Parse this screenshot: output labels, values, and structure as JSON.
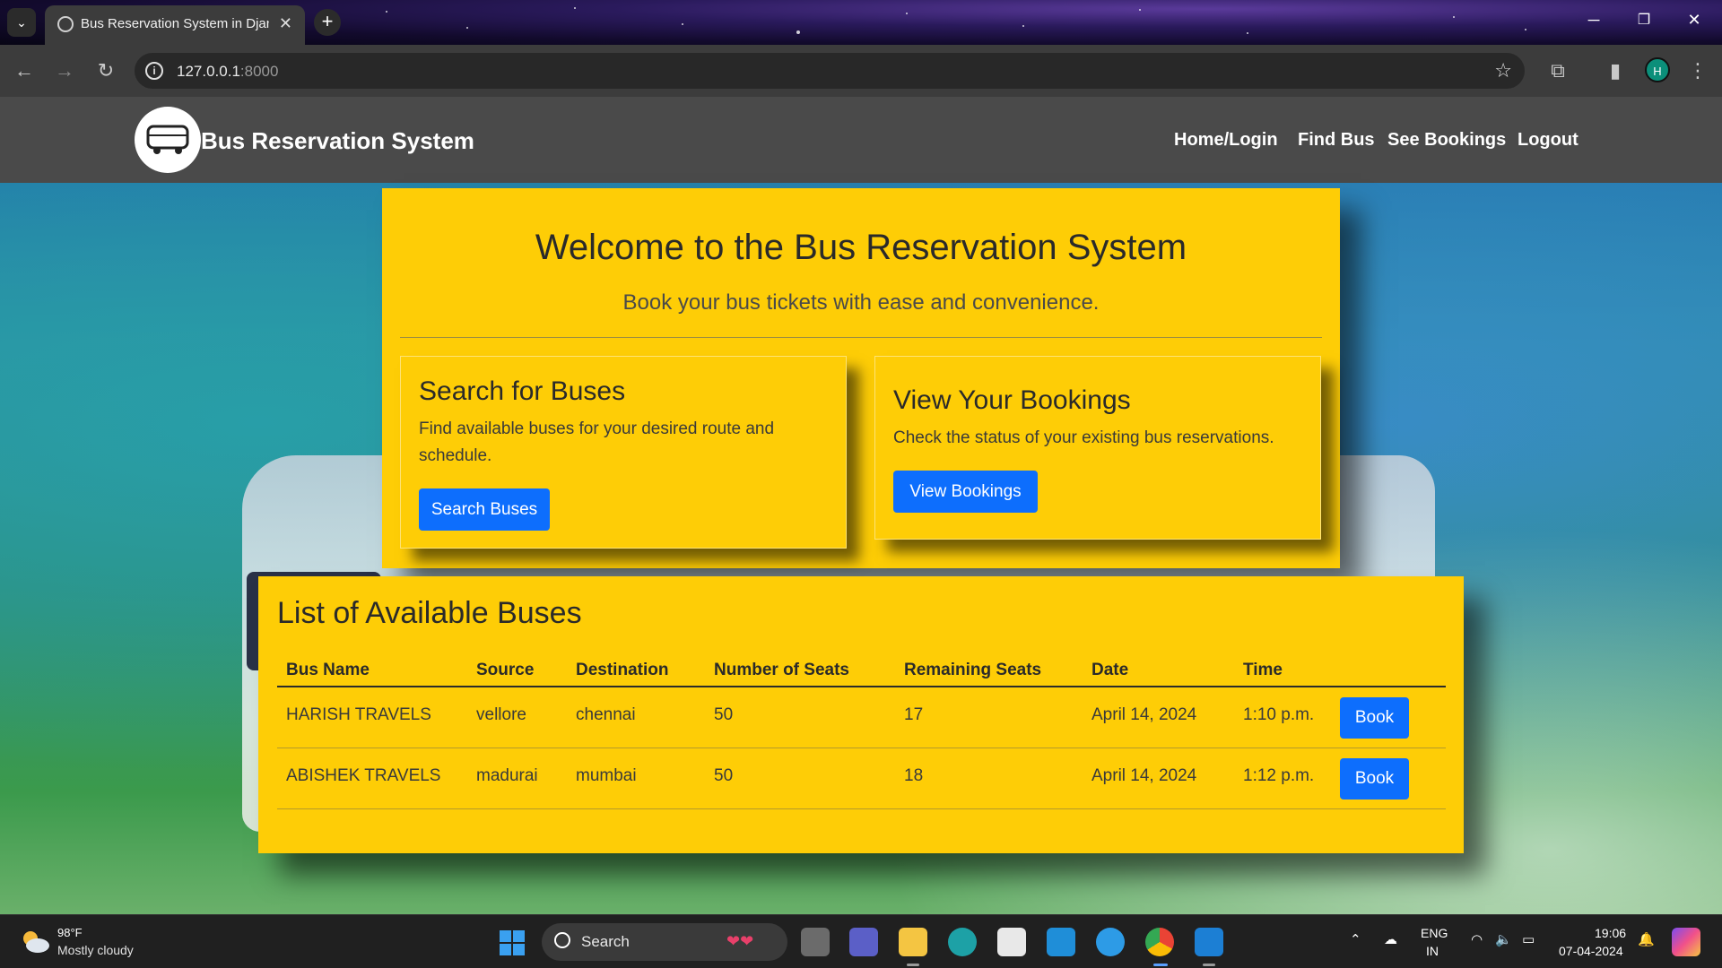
{
  "browser": {
    "tab_title": "Bus Reservation System in Django",
    "url_host": "127.0.0.1",
    "url_port": ":8000",
    "profile_initial": "H"
  },
  "navbar": {
    "brand": "Bus Reservation System",
    "links": [
      "Home/Login",
      "Find Bus",
      "See Bookings",
      "Logout"
    ]
  },
  "hero": {
    "title": "Welcome to the Bus Reservation System",
    "subtitle": "Book your bus tickets with ease and convenience."
  },
  "search_card": {
    "title": "Search for Buses",
    "text": "Find available buses for your desired route and schedule.",
    "button": "Search Buses"
  },
  "bookings_card": {
    "title": "View Your Bookings",
    "text": "Check the status of your existing bus reservations.",
    "button": "View Bookings"
  },
  "buses": {
    "title": "List of Available Buses",
    "columns": [
      "Bus Name",
      "Source",
      "Destination",
      "Number of Seats",
      "Remaining Seats",
      "Date",
      "Time"
    ],
    "rows": [
      {
        "bus_name": "HARISH TRAVELS",
        "source": "vellore",
        "destination": "chennai",
        "seats": "50",
        "remaining": "17",
        "date": "April 14, 2024",
        "time": "1:10 p.m.",
        "action": "Book"
      },
      {
        "bus_name": "ABISHEK TRAVELS",
        "source": "madurai",
        "destination": "mumbai",
        "seats": "50",
        "remaining": "18",
        "date": "April 14, 2024",
        "time": "1:12 p.m.",
        "action": "Book"
      }
    ]
  },
  "colors": {
    "navbar": "#4a4a4a",
    "panel": "#fecd06",
    "primary_button": "#0d6efd"
  },
  "taskbar": {
    "weather_temp": "98°F",
    "weather_condition": "Mostly cloudy",
    "search_label": "Search",
    "language": "ENG",
    "region": "IN",
    "time": "19:06",
    "date": "07-04-2024"
  }
}
